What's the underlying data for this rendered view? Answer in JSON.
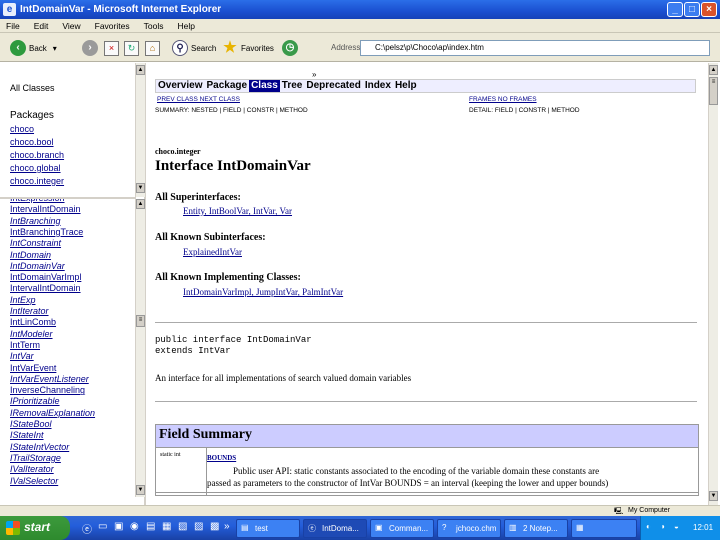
{
  "window": {
    "title": "IntDomainVar - Microsoft Internet Explorer"
  },
  "menu": [
    "File",
    "Edit",
    "View",
    "Favorites",
    "Tools",
    "Help"
  ],
  "toolbar": {
    "back": "Back",
    "search": "Search",
    "favorites": "Favorites",
    "address_label": "Address",
    "address_value": "C:\\pelsz\\p\\Choco\\ap\\index.htm"
  },
  "left_top": {
    "all_classes": "All Classes",
    "packages_heading": "Packages",
    "packages": [
      "choco",
      "choco.bool",
      "choco.branch",
      "choco.global",
      "choco.integer"
    ]
  },
  "left_classes": [
    {
      "t": "IntExpression",
      "i": false
    },
    {
      "t": "IntervalIntDomain",
      "i": false
    },
    {
      "t": "IntBranching",
      "i": true
    },
    {
      "t": "IntBranchingTrace",
      "i": false
    },
    {
      "t": "IntConstraint",
      "i": true
    },
    {
      "t": "IntDomain",
      "i": true
    },
    {
      "t": "IntDomainVar",
      "i": true
    },
    {
      "t": "IntDomainVarImpl",
      "i": false
    },
    {
      "t": "IntervalIntDomain",
      "i": false
    },
    {
      "t": "IntExp",
      "i": true
    },
    {
      "t": "IntIterator",
      "i": true
    },
    {
      "t": "IntLinComb",
      "i": false
    },
    {
      "t": "IntModeler",
      "i": true
    },
    {
      "t": "IntTerm",
      "i": false
    },
    {
      "t": "IntVar",
      "i": true
    },
    {
      "t": "IntVarEvent",
      "i": false
    },
    {
      "t": "IntVarEventListener",
      "i": true
    },
    {
      "t": "InverseChanneling",
      "i": false
    },
    {
      "t": "IPrioritizable",
      "i": true
    },
    {
      "t": "IRemovalExplanation",
      "i": true
    },
    {
      "t": "IStateBool",
      "i": true
    },
    {
      "t": "IStateInt",
      "i": true
    },
    {
      "t": "IStateIntVector",
      "i": true
    },
    {
      "t": "ITrailStorage",
      "i": true
    },
    {
      "t": "IValIterator",
      "i": true
    },
    {
      "t": "IValSelector",
      "i": true
    }
  ],
  "nav": {
    "items": [
      "Overview",
      "Package",
      "Class",
      "Tree",
      "Deprecated",
      "Index",
      "Help"
    ],
    "selected": "Class",
    "prev_next": "PREV CLASS   NEXT CLASS",
    "frames": "FRAMES   NO FRAMES",
    "summary": "SUMMARY: NESTED | FIELD | CONSTR | METHOD",
    "detail": "DETAIL: FIELD | CONSTR | METHOD"
  },
  "doc": {
    "package": "choco.integer",
    "title": "Interface IntDomainVar",
    "superinterfaces_heading": "All Superinterfaces:",
    "superinterfaces": "Entity, IntBoolVar, IntVar, Var",
    "subinterfaces_heading": "All Known Subinterfaces:",
    "subinterfaces": "ExplainedIntVar",
    "impl_heading": "All Known Implementing Classes:",
    "impl": "IntDomainVarImpl, JumpIntVar, PalmIntVar",
    "decl1": "public interface IntDomainVar",
    "decl2": "extends IntVar",
    "description": "An interface for all implementations of search valued domain variables",
    "field_summary": "Field Summary",
    "field_type": "static int",
    "field_name": "BOUNDS",
    "field_desc1": "Public user API: static constants associated to the encoding of the variable domain these constants are",
    "field_desc2": "passed as parameters to the constructor of IntVar BOUNDS = an interval (keeping the lower and upper bounds)"
  },
  "status": {
    "zone": "My Computer"
  },
  "taskbar": {
    "start": "start",
    "tasks": [
      "test",
      "IntDoma...",
      "Comman...",
      "jchoco.chm",
      "2 Notep..."
    ],
    "clock": "12:01"
  }
}
